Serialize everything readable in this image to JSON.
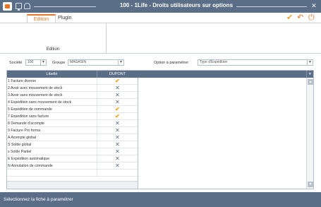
{
  "window": {
    "title": "100 - 1Life - Droits utilisateurs sur options",
    "close_glyph": "✕"
  },
  "tabs": [
    {
      "label": "Edition"
    },
    {
      "label": "Plugin"
    }
  ],
  "ribbon": {
    "group_label": "Edition",
    "actions": {
      "validate_icon": "checkmark-icon",
      "back_icon": "undo-arrow-icon",
      "power_icon": "power-icon"
    }
  },
  "filters": {
    "societe_label": "Société",
    "societe_value": "100",
    "groupe_label": "Groupe",
    "groupe_value": "MAGASIN",
    "option_label": "Option à paramétrer",
    "option_value": "Type d'Expédition"
  },
  "grid": {
    "columns": [
      "Libellé",
      "DUPONT"
    ],
    "rows": [
      {
        "label": "1 Facture diverse",
        "allowed": true
      },
      {
        "label": "2 Avoir avec mouvement de stock",
        "allowed": false
      },
      {
        "label": "3 Avoir sans mouvement de stock",
        "allowed": false
      },
      {
        "label": "4 Expédition sans mouvement de stock",
        "allowed": false
      },
      {
        "label": "5 Expédition de commande",
        "allowed": true
      },
      {
        "label": "7 Expédition sans facture",
        "allowed": true
      },
      {
        "label": "8 Demande d'acompte",
        "allowed": false
      },
      {
        "label": "9 Facture Pro forma",
        "allowed": false
      },
      {
        "label": "A Acompte global",
        "allowed": false
      },
      {
        "label": "S Solde global",
        "allowed": false
      },
      {
        "label": "s Solde Partiel",
        "allowed": false
      },
      {
        "label": "E Expédition automatique",
        "allowed": false
      },
      {
        "label": "N Annulation de commande",
        "allowed": false
      }
    ]
  },
  "status": {
    "message": "Sélectionnez la fiche à paramétrer"
  },
  "colors": {
    "primary": "#5b6e87",
    "accent": "#e8742a",
    "check": "#f0a020"
  }
}
